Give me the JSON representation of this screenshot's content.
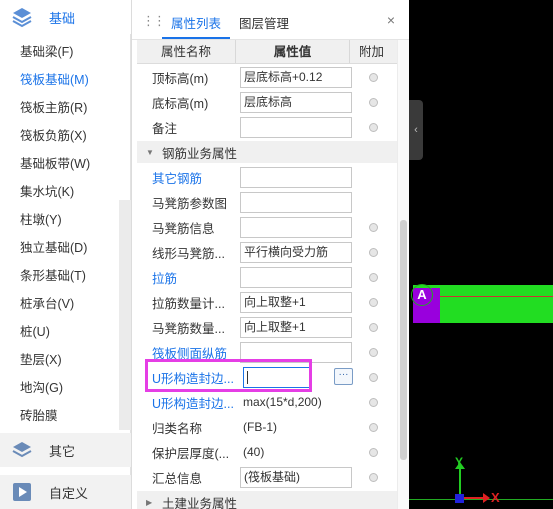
{
  "sidebar": {
    "categories": {
      "basic": {
        "label": "基础",
        "icon": "layers-icon"
      },
      "other": {
        "label": "其它",
        "icon": "stack-icon"
      },
      "custom": {
        "label": "自定义",
        "icon": "play-icon"
      }
    },
    "items": [
      {
        "label": "基础梁(F)",
        "active": false
      },
      {
        "label": "筏板基础(M)",
        "active": true
      },
      {
        "label": "筏板主筋(R)",
        "active": false
      },
      {
        "label": "筏板负筋(X)",
        "active": false
      },
      {
        "label": "基础板带(W)",
        "active": false
      },
      {
        "label": "集水坑(K)",
        "active": false
      },
      {
        "label": "柱墩(Y)",
        "active": false
      },
      {
        "label": "独立基础(D)",
        "active": false
      },
      {
        "label": "条形基础(T)",
        "active": false
      },
      {
        "label": "桩承台(V)",
        "active": false
      },
      {
        "label": "桩(U)",
        "active": false
      },
      {
        "label": "垫层(X)",
        "active": false
      },
      {
        "label": "地沟(G)",
        "active": false
      },
      {
        "label": "砖胎膜",
        "active": false
      }
    ]
  },
  "panel": {
    "tabs": {
      "properties": "属性列表",
      "layers": "图层管理"
    },
    "close_glyph": "×",
    "grip_glyph": "⋮⋮",
    "header": {
      "name": "属性名称",
      "value": "属性值",
      "extra": "附加"
    },
    "rows_top": [
      {
        "name": "顶标高(m)",
        "value": "层底标高+0.12",
        "radio": true
      },
      {
        "name": "底标高(m)",
        "value": "层底标高",
        "radio": true
      },
      {
        "name": "备注",
        "value": "",
        "radio": true
      }
    ],
    "group_rebar": {
      "toggle": "▼",
      "label": "钢筋业务属性"
    },
    "rows_rebar": [
      {
        "name": "其它钢筋",
        "value": "",
        "blue": true,
        "radio": false
      },
      {
        "name": "马凳筋参数图",
        "value": "",
        "blue": false,
        "radio": false
      },
      {
        "name": "马凳筋信息",
        "value": "",
        "blue": false,
        "radio": true
      },
      {
        "name": "线形马凳筋...",
        "value": "平行横向受力筋",
        "blue": false,
        "radio": true
      },
      {
        "name": "拉筋",
        "value": "",
        "blue": true,
        "radio": true
      },
      {
        "name": "拉筋数量计...",
        "value": "向上取整+1",
        "blue": false,
        "radio": true
      },
      {
        "name": "马凳筋数量...",
        "value": "向上取整+1",
        "blue": false,
        "radio": true
      },
      {
        "name": "筏板侧面纵筋",
        "value": "",
        "blue": true,
        "radio": true
      },
      {
        "name": "U形构造封边...",
        "value": "",
        "blue": true,
        "radio": true,
        "editing": true
      },
      {
        "name": "U形构造封边...",
        "value": "max(15*d,200)",
        "blue": true,
        "radio": true,
        "plain": true
      },
      {
        "name": "归类名称",
        "value": "(FB-1)",
        "blue": false,
        "radio": true,
        "plain": true
      },
      {
        "name": "保护层厚度(...",
        "value": "(40)",
        "blue": false,
        "radio": true,
        "plain": true
      },
      {
        "name": "汇总信息",
        "value": "(筏板基础)",
        "blue": false,
        "radio": true
      }
    ],
    "group_civil": {
      "toggle": "▶",
      "label": "土建业务属性"
    },
    "ellipsis": "···"
  },
  "viewport": {
    "axis_label": "A",
    "y_label": "Y",
    "x_label": "X",
    "collapse_glyph": "‹",
    "colors": {
      "slab": "#22dd22",
      "column": "#9900dd",
      "background": "#000000"
    }
  }
}
